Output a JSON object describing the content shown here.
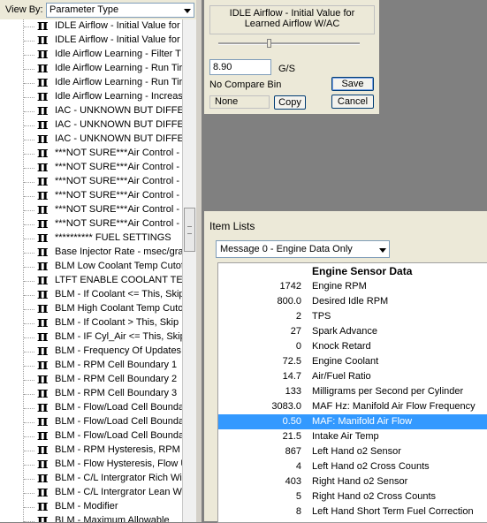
{
  "viewby": {
    "label": "View By:",
    "value": "Parameter Type"
  },
  "tree": {
    "items": [
      "IDLE Airflow - Initial Value for",
      "IDLE Airflow - Initial Value for",
      "Idle Airflow Learning - Filter T",
      "Idle Airflow Learning - Run Tir",
      "Idle Airflow Learning - Run Tir",
      "Idle Airflow Learning - Increas",
      "IAC - UNKNOWN BUT DIFFER",
      "IAC - UNKNOWN BUT DIFFER",
      "IAC - UNKNOWN BUT DIFFER",
      "***NOT SURE***Air Control -",
      "***NOT SURE***Air Control -",
      "***NOT SURE***Air Control -",
      "***NOT SURE***Air Control -",
      "***NOT SURE***Air Control -",
      "***NOT SURE***Air Control -",
      "********** FUEL SETTINGS",
      "Base Injector Rate - msec/gra",
      "BLM Low Coolant Temp Cutof",
      "LTFT ENABLE COOLANT TEMF",
      "BLM - If Coolant <= This, Skip",
      "BLM High Coolant Temp Cutof",
      "BLM - If Coolant > This, Skip L",
      "BLM - IF Cyl_Air <= This, Skip",
      "BLM - Frequency Of Updates",
      "BLM - RPM Cell Boundary 1",
      "BLM - RPM Cell Boundary 2",
      "BLM - RPM Cell Boundary 3",
      "BLM - Flow/Load Cell Boundar",
      "BLM - Flow/Load Cell Boundar",
      "BLM - Flow/Load Cell Boundar",
      "BLM - RPM Hysteresis, RPM U",
      "BLM - Flow Hysteresis, Flow U",
      "BLM - C/L Intergrator Rich Wir",
      "BLM - C/L Intergrator Lean Wi",
      "BLM - Modifier",
      "BLM - Maximum Allowable"
    ]
  },
  "param": {
    "title": "IDLE Airflow - Initial Value for Learned Airflow W/AC",
    "value": "8.90",
    "units": "G/S",
    "compare_label": "No Compare Bin",
    "compare_value": "None",
    "save_label": "Save",
    "copy_label": "Copy",
    "cancel_label": "Cancel"
  },
  "item_lists": {
    "title": "Item Lists",
    "selected_list": "Message 0 - Engine Data Only",
    "header": "Engine Sensor Data",
    "rows": [
      {
        "value": "1742",
        "name": "Engine RPM"
      },
      {
        "value": "800.0",
        "name": "Desired Idle RPM"
      },
      {
        "value": "2",
        "name": "TPS"
      },
      {
        "value": "27",
        "name": "Spark Advance"
      },
      {
        "value": "0",
        "name": "Knock Retard"
      },
      {
        "value": "72.5",
        "name": "Engine Coolant"
      },
      {
        "value": "14.7",
        "name": "Air/Fuel Ratio"
      },
      {
        "value": "133",
        "name": "Milligrams per Second per Cylinder"
      },
      {
        "value": "3083.0",
        "name": "MAF Hz: Manifold Air Flow Frequency"
      },
      {
        "value": "0.50",
        "name": "MAF: Manifold Air Flow",
        "selected": true
      },
      {
        "value": "21.5",
        "name": "Intake Air Temp"
      },
      {
        "value": "867",
        "name": "Left Hand o2 Sensor"
      },
      {
        "value": "4",
        "name": "Left Hand o2 Cross Counts"
      },
      {
        "value": "403",
        "name": "Right Hand o2 Sensor"
      },
      {
        "value": "5",
        "name": "Right Hand o2 Cross Counts"
      },
      {
        "value": "8",
        "name": "Left Hand Short Term Fuel Correction"
      }
    ]
  },
  "colors": {
    "selection": "#3399ff",
    "desktop": "#808080",
    "dialog": "#ece9d8"
  },
  "icons": {
    "tree_item": "pi-icon"
  }
}
